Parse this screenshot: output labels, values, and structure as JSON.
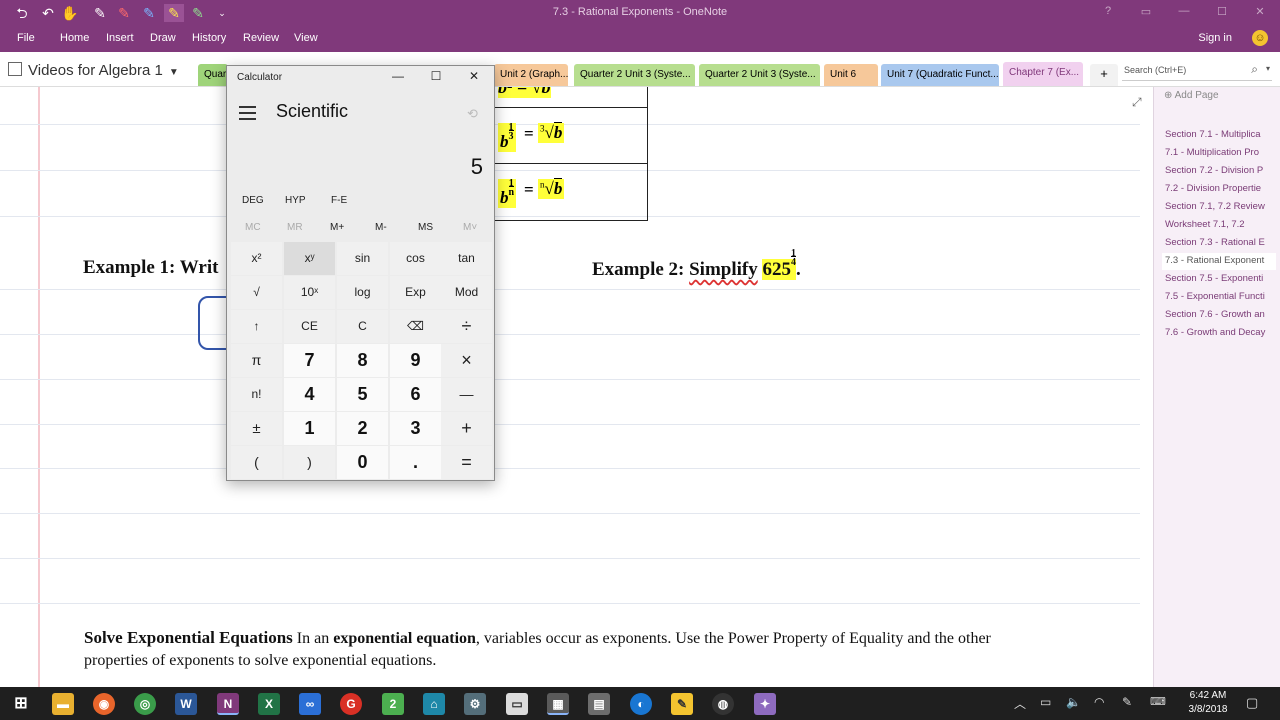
{
  "onenote": {
    "window_title": "7.3 - Rational Exponents - OneNote",
    "menu": [
      "File",
      "Home",
      "Insert",
      "Draw",
      "History",
      "Review",
      "View"
    ],
    "sign_in": "Sign in",
    "notebook_name": "Videos for Algebra 1",
    "section_tabs": [
      {
        "label": "Quart",
        "color": "#9fd47a"
      },
      {
        "label": "Unit 2 (Graph...",
        "color": "#f6c89a"
      },
      {
        "label": "Quarter 2 Unit 3 (Syste...",
        "color": "#b7de8f"
      },
      {
        "label": "Quarter 2 Unit 3 (Syste...",
        "color": "#b7de8f"
      },
      {
        "label": "Unit 6",
        "color": "#f6c89a"
      },
      {
        "label": "Unit 7 (Quadratic Funct...",
        "color": "#a9c8ee"
      },
      {
        "label": "Chapter 7 (Ex...",
        "color": "#f1d1ef"
      }
    ],
    "add_tab": "+",
    "search_placeholder": "Search (Ctrl+E)",
    "add_page": "Add Page",
    "pages": [
      "Section 7.1 - Multiplica",
      "7.1 - Multiplication Pro",
      "Section 7.2 - Division P",
      "7.2 - Division Propertie",
      "Section 7.1, 7.2 Review",
      "Worksheet 7.1, 7.2",
      "Section 7.3 - Rational E",
      "7.3 - Rational Exponent",
      "Section 7.5 - Exponenti",
      "7.5 - Exponential Functi",
      "Section 7.6 - Growth an",
      "7.6 - Growth and Decay"
    ],
    "active_page_index": 7
  },
  "page": {
    "example1": "Example 1: Writ",
    "example2_prefix": "Example 2:",
    "example2_word": "Simplify",
    "example2_base": "625",
    "exp_num": "1",
    "exp_den": "4",
    "example2_period": ".",
    "table_rows": [
      {
        "base": "b",
        "num": "1",
        "den": "3",
        "eq": "=",
        "idx": "3",
        "rad": "b"
      },
      {
        "base": "b",
        "num": "1",
        "den": "n",
        "eq": "=",
        "idx": "n",
        "rad": "b"
      }
    ],
    "solve_heading": "Solve Exponential Equations",
    "solve_text_1": " In an ",
    "solve_bold": "exponential equation",
    "solve_text_2": ", variables occur as exponents. Use the Power Property of Equality and the other properties of exponents to solve exponential equations."
  },
  "calculator": {
    "title": "Calculator",
    "mode": "Scientific",
    "display": "5",
    "angle_row": [
      "DEG",
      "HYP",
      "F-E"
    ],
    "memory_row": [
      "MC",
      "MR",
      "M+",
      "M-",
      "MS",
      "M˅"
    ],
    "keys": [
      [
        "x²",
        "xʸ",
        "sin",
        "cos",
        "tan"
      ],
      [
        "√",
        "10ˣ",
        "log",
        "Exp",
        "Mod"
      ],
      [
        "↑",
        "CE",
        "C",
        "⌫",
        "÷"
      ],
      [
        "π",
        "7",
        "8",
        "9",
        "×"
      ],
      [
        "n!",
        "4",
        "5",
        "6",
        "—"
      ],
      [
        "±",
        "1",
        "2",
        "3",
        "+"
      ],
      [
        "(",
        ")",
        "0",
        ".",
        "="
      ]
    ]
  },
  "taskbar": {
    "time": "6:42 AM",
    "date": "3/8/2018"
  }
}
